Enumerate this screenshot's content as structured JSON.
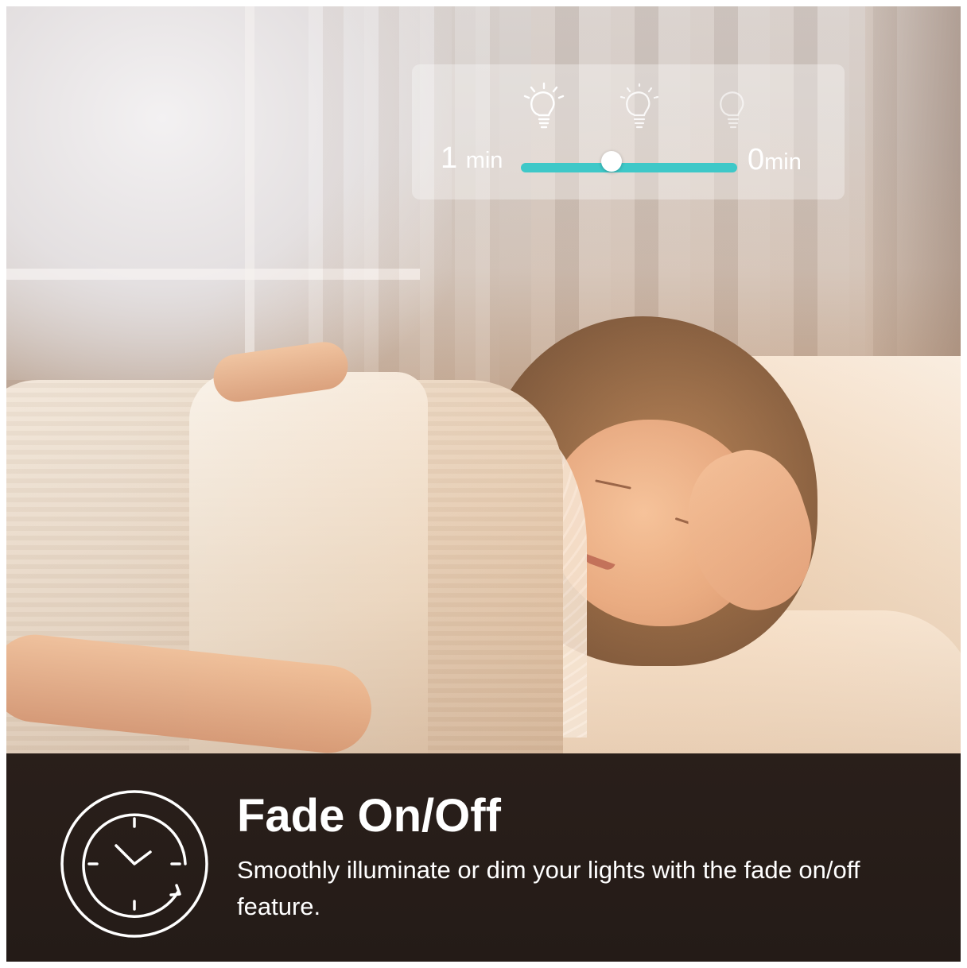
{
  "fade_control": {
    "bulbs": [
      "bright-bulb-icon",
      "dim-bulb-icon",
      "off-bulb-icon"
    ],
    "left_value": "1",
    "left_unit": "min",
    "right_value": "0",
    "right_unit": "min",
    "slider_position": 0.42,
    "slider_color": "#3ec8c8"
  },
  "caption": {
    "icon": "clock-icon",
    "title": "Fade On/Off",
    "description": "Smoothly illuminate or dim your lights with the fade on/off feature."
  }
}
